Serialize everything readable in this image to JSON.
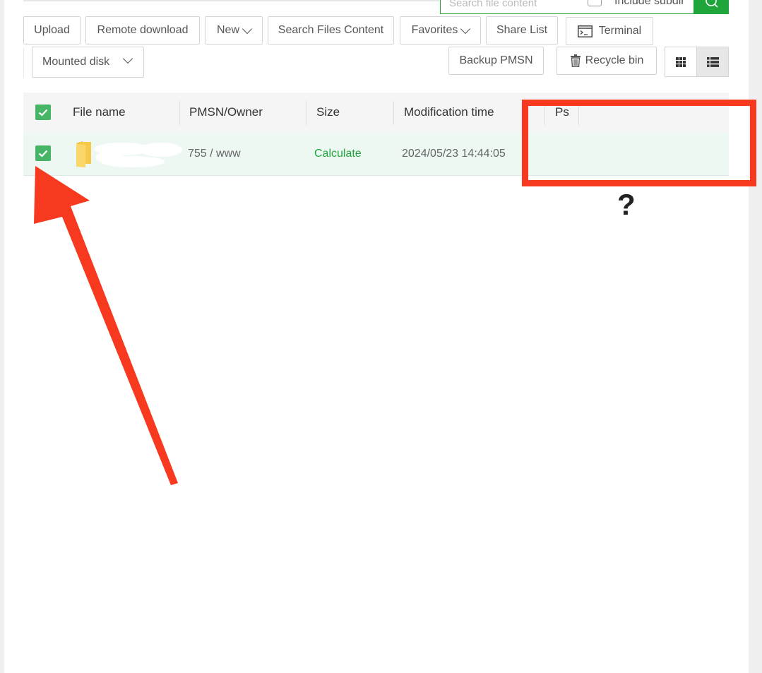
{
  "search": {
    "placeholder": "Search file content",
    "include_subdir_label": "Include subdir"
  },
  "toolbar": {
    "upload": "Upload",
    "remote_download": "Remote download",
    "new": "New",
    "search_files_content": "Search Files Content",
    "favorites": "Favorites",
    "share_list": "Share List",
    "terminal": "Terminal",
    "backup": "Backup PMSN",
    "recycle_bin": "Recycle bin"
  },
  "disk_select": {
    "selected": "Mounted disk"
  },
  "table": {
    "headers": {
      "file_name": "File name",
      "owner": "PMSN/Owner",
      "size": "Size",
      "mtime": "Modification time",
      "ps": "Ps"
    },
    "rows": [
      {
        "name": "",
        "owner": "755 / www",
        "size": "Calculate",
        "mtime": "2024/05/23 14:44:05",
        "ps": ""
      }
    ]
  },
  "annotation": {
    "question": "?"
  },
  "colors": {
    "accent": "#20a53a",
    "checkbox": "#47b566",
    "annotation_red": "#f73a1f",
    "folder": "#f7c948"
  }
}
